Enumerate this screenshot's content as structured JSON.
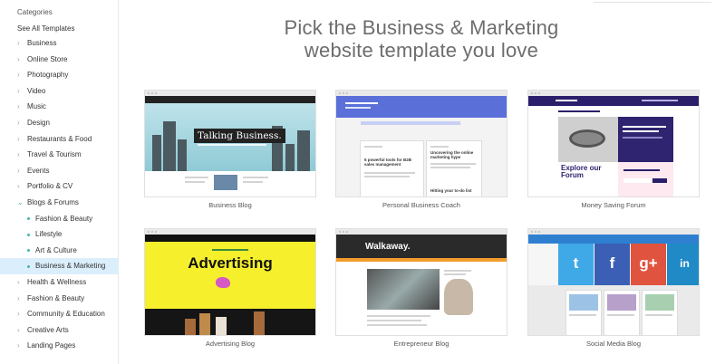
{
  "sidebar": {
    "heading": "Categories",
    "see_all": "See All Templates",
    "items": [
      {
        "label": "Business",
        "type": "cat"
      },
      {
        "label": "Online Store",
        "type": "cat"
      },
      {
        "label": "Photography",
        "type": "cat"
      },
      {
        "label": "Video",
        "type": "cat"
      },
      {
        "label": "Music",
        "type": "cat"
      },
      {
        "label": "Design",
        "type": "cat"
      },
      {
        "label": "Restaurants & Food",
        "type": "cat"
      },
      {
        "label": "Travel & Tourism",
        "type": "cat"
      },
      {
        "label": "Events",
        "type": "cat"
      },
      {
        "label": "Portfolio & CV",
        "type": "cat"
      },
      {
        "label": "Blogs & Forums",
        "type": "open"
      },
      {
        "label": "Fashion & Beauty",
        "type": "sub"
      },
      {
        "label": "Lifestyle",
        "type": "sub"
      },
      {
        "label": "Art & Culture",
        "type": "sub"
      },
      {
        "label": "Business & Marketing",
        "type": "active"
      },
      {
        "label": "Health & Wellness",
        "type": "cat"
      },
      {
        "label": "Fashion & Beauty",
        "type": "cat"
      },
      {
        "label": "Community & Education",
        "type": "cat"
      },
      {
        "label": "Creative Arts",
        "type": "cat"
      },
      {
        "label": "Landing Pages",
        "type": "cat"
      }
    ]
  },
  "hero": {
    "line1": "Pick the Business & Marketing",
    "line2": "website template you love"
  },
  "templates": [
    {
      "caption": "Business Blog",
      "thumb_title": "Talking Business."
    },
    {
      "caption": "Personal Business Coach",
      "thumb_headline1": "5 powerful tools for B2B sales management",
      "thumb_headline2": "Uncovering the online marketing hype",
      "thumb_headline3": "Hitting your to-do list"
    },
    {
      "caption": "Money Saving Forum",
      "thumb_title": "Explore our Forum"
    },
    {
      "caption": "Advertising Blog",
      "thumb_title": "Advertising"
    },
    {
      "caption": "Entrepreneur Blog",
      "thumb_title": "Walkaway."
    },
    {
      "caption": "Social Media Blog",
      "tiles": [
        {
          "glyph": "t",
          "color": "#3fa8e6"
        },
        {
          "glyph": "f",
          "color": "#3b5fb4"
        },
        {
          "glyph": "g+",
          "color": "#e0533f"
        },
        {
          "glyph": "in",
          "color": "#1f8ac6"
        }
      ]
    }
  ],
  "colors": {
    "accent": "#42b8a6",
    "active_bg": "#dbeefb"
  }
}
